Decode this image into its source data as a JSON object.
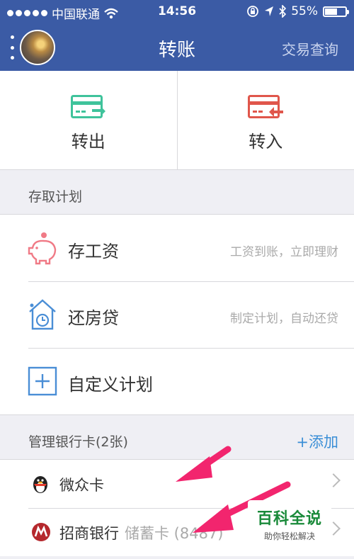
{
  "status_bar": {
    "carrier": "中国联通",
    "time": "14:56",
    "battery": "55%",
    "battery_level": 0.55
  },
  "nav": {
    "title": "转账",
    "right_link": "交易查询"
  },
  "transfer": {
    "out_label": "转出",
    "in_label": "转入"
  },
  "plans": {
    "header": "存取计划",
    "items": [
      {
        "name": "存工资",
        "desc": "工资到账，立即理财",
        "icon": "piggy-bank-icon"
      },
      {
        "name": "还房贷",
        "desc": "制定计划，自动还贷",
        "icon": "house-clock-icon"
      },
      {
        "name": "自定义计划",
        "desc": "",
        "icon": "plus-box-icon"
      }
    ]
  },
  "cards": {
    "header": "管理银行卡(2张)",
    "add_label": "+添加",
    "items": [
      {
        "name": "微众卡",
        "sub": "",
        "icon": "penguin-icon"
      },
      {
        "name": "招商银行",
        "sub": "储蓄卡 (8487)",
        "icon": "cmb-logo-icon"
      }
    ]
  },
  "watermark": {
    "big": "百科全说",
    "small": "助你轻松解决"
  },
  "colors": {
    "nav_bg": "#3b5ba5",
    "out_green": "#3fc39b",
    "in_red": "#e0564b",
    "accent_blue": "#3a8ed6",
    "annotation_pink": "#f2256e"
  }
}
